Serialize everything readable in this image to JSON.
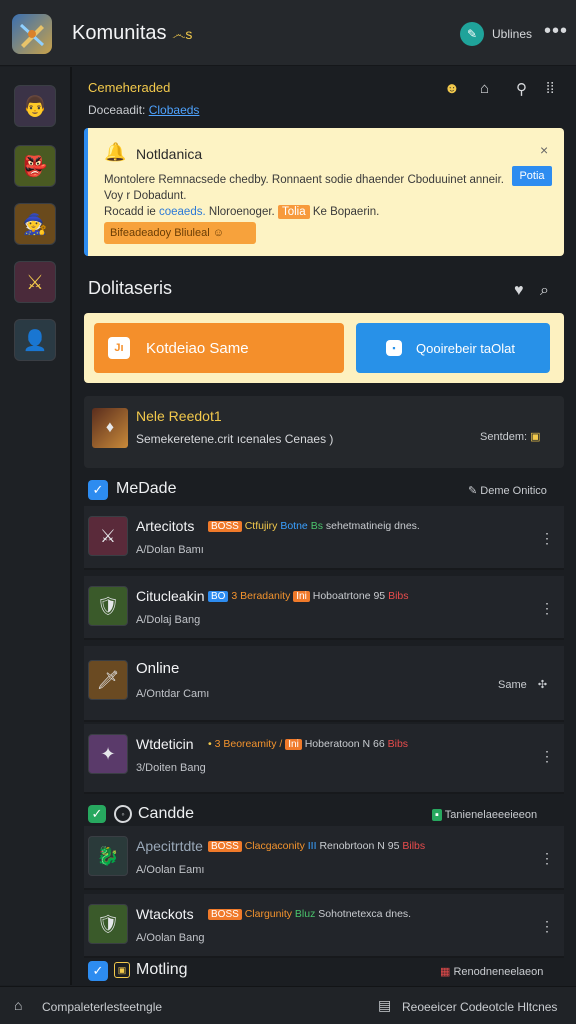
{
  "header": {
    "title": "Komunitas",
    "title_badge": "෴s",
    "online_label": "Ublines",
    "more": "•••"
  },
  "sidebar": {
    "avatars": [
      {
        "name": "portrait-suit",
        "glyph": "👨"
      },
      {
        "name": "goblin-gold",
        "glyph": "👺"
      },
      {
        "name": "warrior-gold",
        "glyph": "🧙"
      },
      {
        "name": "crossed-swords",
        "glyph": "⚔"
      },
      {
        "name": "portrait-dark",
        "glyph": "👤"
      }
    ]
  },
  "section": {
    "title": "Cemeheraded",
    "subtitle_text": "Doceaadit:",
    "subtitle_link": "Clobaeds"
  },
  "notification": {
    "title": "Notldanica",
    "line1": "Montolere Remnacsede chedby. Ronnaent sodie dhaender Cboduuinet anneir.",
    "line2": "Voy r Dobadunt.",
    "line3_a": "Rocadd ie",
    "line3_link": "coeaeds.",
    "line3_b": "Nloroenoger.",
    "line3_tag": "Tolia",
    "line3_c": "Ke Bopaerin.",
    "button": "Potia",
    "pill": "Bifeadeadoy Bliuleal",
    "close": "×"
  },
  "discover": {
    "title": "Dolitaseris",
    "primary_button": "Kotdeiao Same",
    "primary_icon_text": "Jı",
    "secondary_button": "Qooirebeir taOlat"
  },
  "featured": {
    "title": "Nele Reedot1",
    "subtitle": "Semekeretene.crit ıcenales Cenaes )",
    "right": "Sentdem:"
  },
  "groups": [
    {
      "title": "MeDade",
      "right": "Deme Onitico"
    },
    {
      "title": "Candde",
      "right": "Tanienelaeeeieeon"
    },
    {
      "title": "Motling",
      "right": "Renodneneelaeon"
    }
  ],
  "rows": [
    {
      "name": "Artecitots",
      "tag": "BOSS",
      "meta_a": "Ctfujiry",
      "meta_b": "Botne",
      "meta_c": "Bs",
      "meta_d": "sehetmatineig dnes.",
      "sub": "A/Dolan Bamı"
    },
    {
      "name": "Citucleakin",
      "tag": "BO",
      "meta_a": "3 Beradanity",
      "meta_b": "Ini",
      "meta_c": "Hoboatrtone 95",
      "meta_d": "Bibs",
      "sub": "A/Dolaj Bang"
    },
    {
      "name": "Online",
      "tag": "",
      "meta_a": "",
      "meta_b": "",
      "meta_c": "",
      "meta_d": "",
      "sub": "A/Ontdar Camı",
      "right": "Same"
    },
    {
      "name": "Wtdeticin",
      "tag": "•",
      "meta_a": "3 Beoreamity /",
      "meta_b": "Ini",
      "meta_c": "Hoberatoon N 66",
      "meta_d": "Bibs",
      "sub": "3/Doiten Bang"
    },
    {
      "name": "Apecitrtdte",
      "tag": "BOSS",
      "meta_a": "Clacgaconity",
      "meta_b": "III",
      "meta_c": "Renobrtoon N 95",
      "meta_d": "Bilbs",
      "sub": "A/Oolan Eamı"
    },
    {
      "name": "Wtackots",
      "tag": "BOSS",
      "meta_a": "Clargunity",
      "meta_b": "Bluz",
      "meta_c": "Sohotnetexca dnes.",
      "meta_d": "",
      "sub": "A/Oolan Bang"
    }
  ],
  "bottom": {
    "left": "Compaleterlesteetngle",
    "right": "Reoeeicer Codeotcle Hltcnes"
  },
  "colors": {
    "accent_blue": "#2d8cf0",
    "accent_orange": "#f48f2b",
    "notice_bg": "#fdf3c4"
  }
}
